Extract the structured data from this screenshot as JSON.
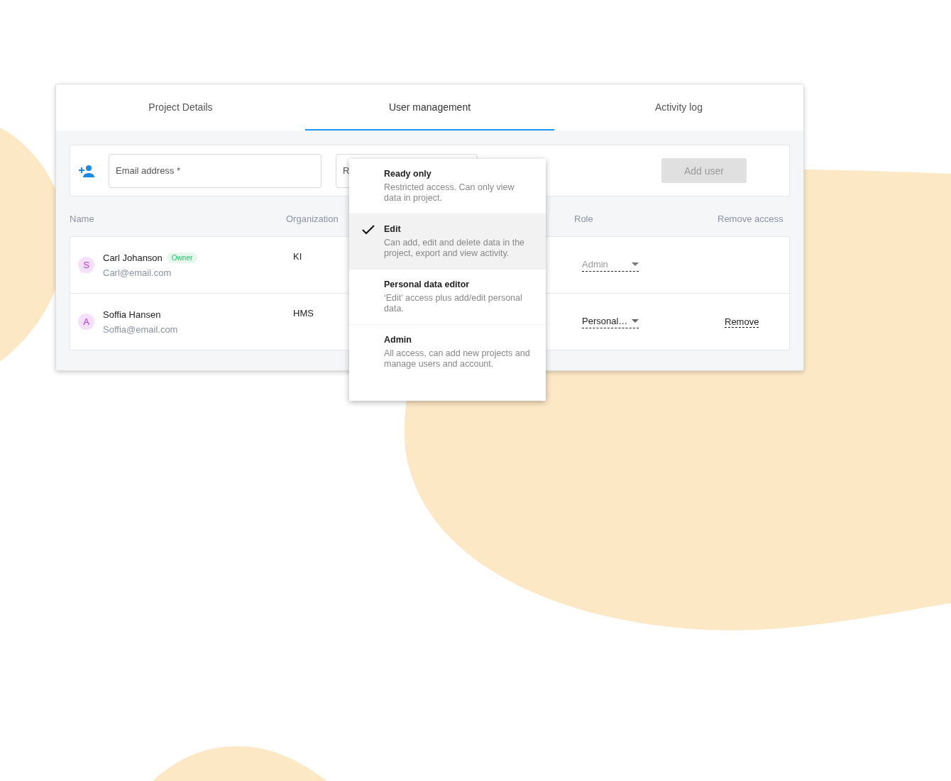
{
  "tabs": [
    {
      "label": "Project Details",
      "selected": false
    },
    {
      "label": "User management",
      "selected": true
    },
    {
      "label": "Activity log",
      "selected": false
    }
  ],
  "add_user": {
    "email": {
      "placeholder": "Email address *"
    },
    "role": {
      "label": "R"
    },
    "button": {
      "label": "Add user",
      "disabled": true
    }
  },
  "table": {
    "columns": [
      "Name",
      "Organization",
      "Role",
      "Remove access"
    ],
    "rows": [
      {
        "avatar": "S",
        "name": "Carl Johanson",
        "badge": "Owner",
        "email": "Carl@email.com",
        "organization": "KI",
        "role": "Admin",
        "role_disabled": true
      },
      {
        "avatar": "A",
        "name": "Soffia Hansen",
        "email": "Soffia@email.com",
        "organization": "HMS",
        "role": "Personal…",
        "role_disabled": false,
        "remove": "Remove"
      }
    ]
  },
  "role_menu": [
    {
      "title": "Ready only",
      "description": "Restricted access. Can only view data in project.",
      "selected": false
    },
    {
      "title": "Edit",
      "description": "Can add, edit and delete data in the project, export and view activity.",
      "selected": true
    },
    {
      "title": "Personal data editor",
      "description": "‘Edit’ access plus add/edit personal data.",
      "selected": false
    },
    {
      "title": "Admin",
      "description": "All access, can add new projects and manage users and account.",
      "selected": false
    }
  ]
}
